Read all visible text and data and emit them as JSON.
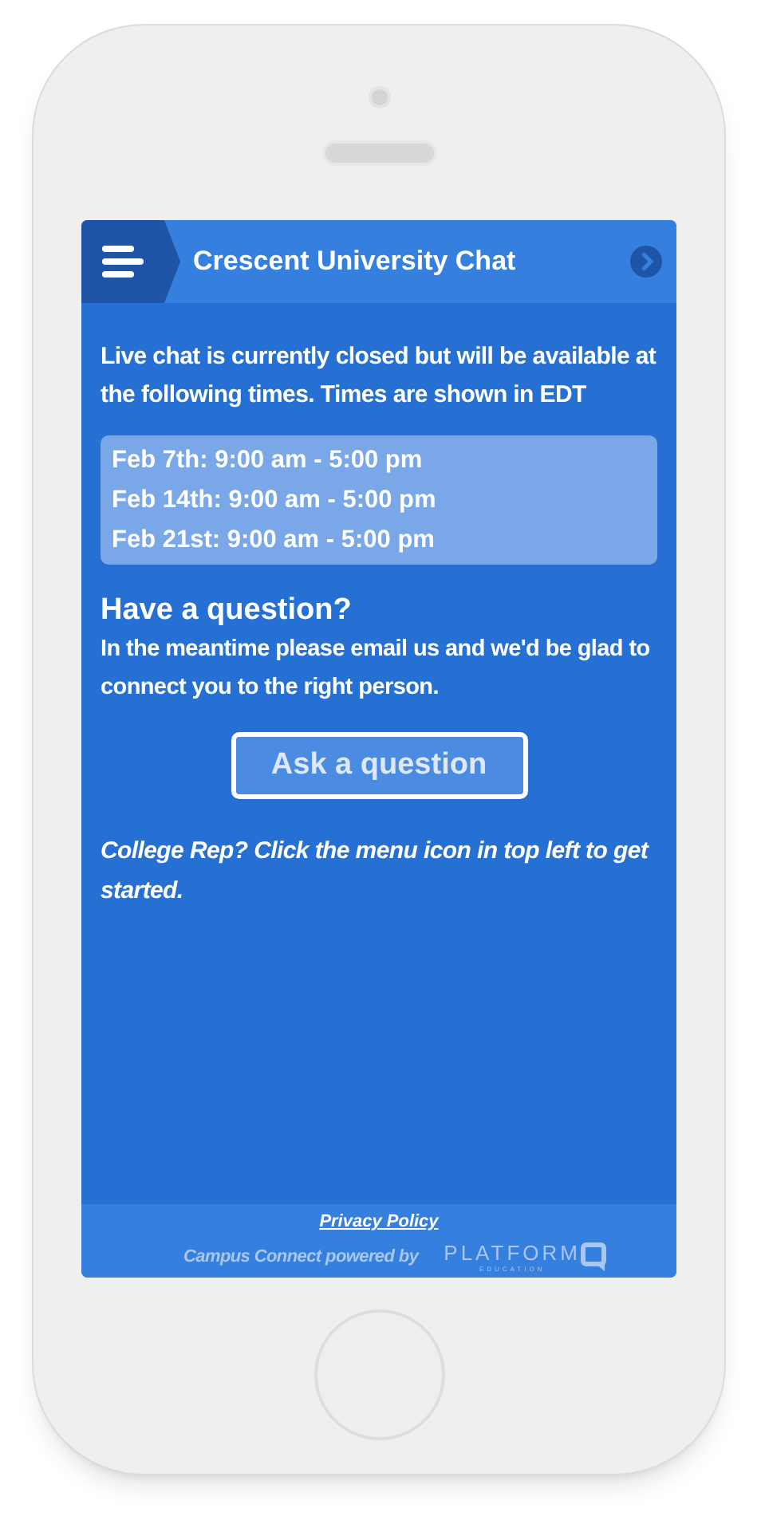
{
  "header": {
    "title": "Crescent University Chat"
  },
  "notice": "Live chat is currently closed but will be available at the following times. Times are shown in EDT",
  "schedule": [
    "Feb 7th: 9:00 am - 5:00 pm",
    "Feb 14th: 9:00 am - 5:00 pm",
    "Feb 21st: 9:00 am - 5:00 pm"
  ],
  "question": {
    "heading": "Have a question?",
    "text": "In the meantime please email us and we'd be glad to connect you to the right person.",
    "button": "Ask a question"
  },
  "rep_note": "College Rep? Click the menu icon in top left to get started.",
  "footer": {
    "privacy_link": "Privacy Policy",
    "powered_by": "Campus Connect powered by",
    "logo_word": "PLATFORM",
    "logo_subword": "EDUCATION"
  }
}
